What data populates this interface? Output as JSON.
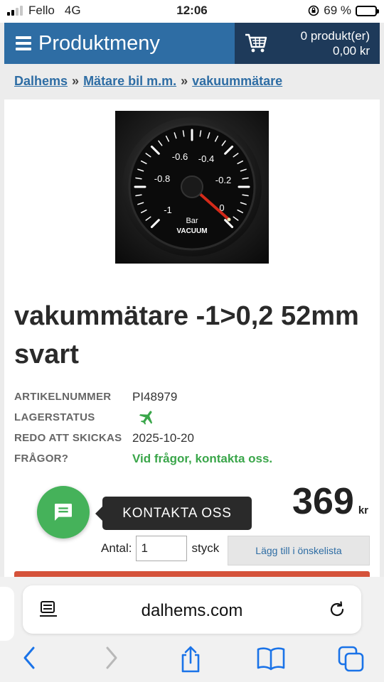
{
  "status_bar": {
    "carrier": "Fello",
    "network": "4G",
    "time": "12:06",
    "battery": "69 %",
    "battery_level": 0.69
  },
  "header": {
    "menu_label": "Produktmeny",
    "cart_count": "0 produkt(er)",
    "cart_total": "0,00 kr"
  },
  "breadcrumb": [
    "Dalhems",
    "Mätare bil m.m.",
    "vakuummätare"
  ],
  "product": {
    "gauge_text": {
      "ticks": [
        "-1",
        "-0.8",
        "-0.6",
        "-0.4",
        "-0.2",
        "0"
      ],
      "unit": "Bar",
      "label": "VACUUM"
    },
    "title": "vakummätare -1>0,2 52mm svart",
    "specs": {
      "article_label": "ARTIKELNUMMER",
      "article_value": "PI48979",
      "stock_label": "LAGERSTATUS",
      "ship_label": "REDO ATT SKICKAS",
      "ship_value": "2025-10-20",
      "questions_label": "FRÅGOR?",
      "questions_link": "Vid frågor, kontakta oss."
    },
    "price": "369",
    "currency": "kr",
    "qty_label": "Antal:",
    "qty_value": "1",
    "qty_unit": "styck",
    "wishlist_label": "Lägg till i önskelista"
  },
  "chat": {
    "tooltip": "KONTAKTA OSS"
  },
  "browser": {
    "url": "dalhems.com"
  },
  "colors": {
    "brand_blue": "#2e6da4",
    "cart_dark": "#1e3a5a",
    "link_green": "#3aa64a",
    "chat_green": "#45b25a",
    "accent_red": "#d5523a",
    "ios_blue": "#1a73e8"
  },
  "icons": {
    "stock_status": "airplane-icon",
    "chat": "chat-icon",
    "cart": "shopping-cart-icon"
  }
}
